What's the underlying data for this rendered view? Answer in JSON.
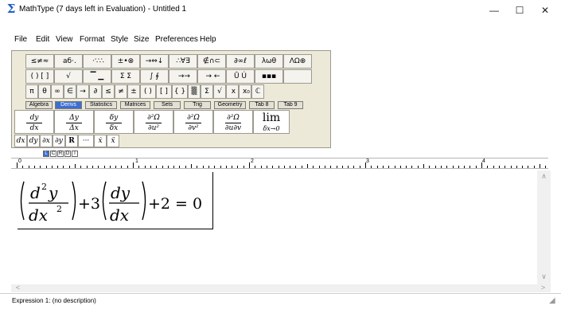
{
  "window": {
    "title": "MathType (7 days left in Evaluation) - Untitled 1",
    "app_icon": "sigma-icon",
    "minimize": "—",
    "maximize": "☐",
    "close": "✕"
  },
  "menu": [
    "File",
    "Edit",
    "View",
    "Format",
    "Style",
    "Size",
    "Preferences",
    "Help"
  ],
  "palettes": {
    "row1": [
      "≤≠≈",
      " аб·.",
      " ·∵∴",
      "±•⊗",
      "→⇔↓",
      "∴∀∃",
      "∉∩⊂",
      "∂∞ℓ",
      "λωθ",
      "ΛΩ⊕"
    ],
    "row2": [
      "( ) [ ]",
      " √ ",
      "▔ ▁",
      "Σ Σ",
      "∫ ∮",
      " →→",
      " → ←",
      "Ū Ú",
      "▪▪▪",
      "   "
    ],
    "row3": [
      "π",
      "θ",
      "∞",
      "∈",
      "→",
      "∂",
      "≤",
      "≠",
      "±",
      "( )",
      "[ ]",
      "{ }",
      "▒",
      "Σ",
      "√",
      " x",
      " x₀",
      "ℂ"
    ]
  },
  "tabs": [
    "Algebra",
    "Derivs",
    "Statistics",
    "Matrices",
    "Sets",
    "Trig",
    "Geometry",
    "Tab 8",
    "Tab 9"
  ],
  "templates": [
    {
      "num": "dy",
      "den": "dx"
    },
    {
      "num": "Δy",
      "den": "Δx"
    },
    {
      "num": "δy",
      "den": "δx"
    },
    {
      "num": "∂²Ω",
      "den": "∂u²"
    },
    {
      "num": "∂²Ω",
      "den": "∂v²"
    },
    {
      "num": "∂²Ω",
      "den": "∂u∂v"
    }
  ],
  "limit_template": {
    "main": "lim",
    "sub": "δx→0"
  },
  "small_buttons": [
    "dx",
    "dy",
    "∂x",
    "∂y",
    "R",
    "···",
    "ẋ",
    "ẍ"
  ],
  "tab_stops": [
    "L",
    "C",
    "R",
    "D",
    "I"
  ],
  "ruler": [
    "0",
    "1",
    "2",
    "3",
    "4"
  ],
  "equation": {
    "d1": "d",
    "exp2a": "2",
    "y": "y",
    "dx": "dx",
    "exp2b": "2",
    "plus1": "+3",
    "dy": "dy",
    "dx2": "dx",
    "rest": "+2 = 0"
  },
  "status": "Expression 1: (no description)"
}
